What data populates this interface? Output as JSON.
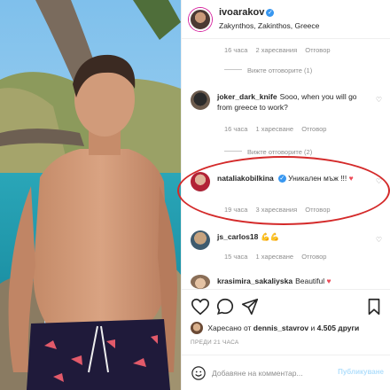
{
  "header": {
    "username": "ivoarakov",
    "location": "Zakynthos, Zakinthos, Greece"
  },
  "comments": [
    {
      "type": "meta-only",
      "time": "16 часа",
      "likes": "2 харесвания",
      "reply": "Отговор",
      "view_replies": "Вижте отговорите (1)"
    },
    {
      "user": "joker_dark_knife",
      "text": "Sooo, when you will go from greece to work?",
      "time": "16 часа",
      "likes": "1 харесване",
      "reply": "Отговор",
      "view_replies": "Вижте отговорите (2)"
    },
    {
      "user": "nataliakobilkina",
      "text": "Уникален мъж !!!",
      "time": "19 часа",
      "likes": "3 харесвания",
      "reply": "Отговор"
    },
    {
      "user": "js_carlos18",
      "text": "",
      "time": "15 часа",
      "likes": "1 харесване",
      "reply": "Отговор"
    },
    {
      "user": "krasimira_sakaliyska",
      "text": "Beautiful"
    }
  ],
  "actions": {
    "liked_prefix": "Харесано от",
    "liked_user": "dennis_stavrov",
    "liked_and": "и",
    "liked_others": "4.505 други",
    "time_ago": "ПРЕДИ 21 ЧАСА",
    "comment_placeholder": "Добавяне на комментар...",
    "post_label": "Публикуване"
  },
  "icons": [
    "like-icon",
    "comment-icon",
    "share-icon",
    "save-icon",
    "emoji-icon",
    "verified-badge-icon",
    "heart-icon"
  ],
  "colors": {
    "highlight": "#d42a2a",
    "link": "#3897f0",
    "heart": "#ed4956",
    "muted": "#8e8e8e"
  }
}
